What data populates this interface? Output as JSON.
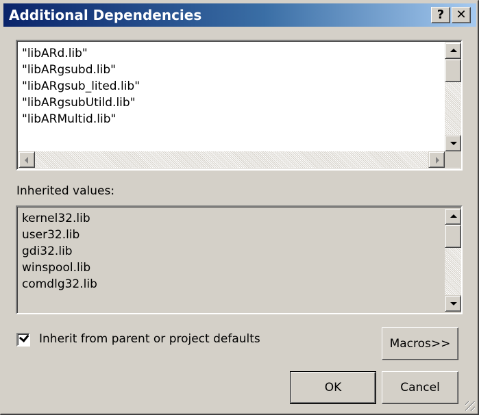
{
  "window": {
    "title": "Additional Dependencies",
    "help_label": "?",
    "close_label": "✕"
  },
  "dependencies": {
    "items": [
      "\"libARd.lib\"",
      "\"libARgsubd.lib\"",
      "\"libARgsub_lited.lib\"",
      "\"libARgsubUtild.lib\"",
      "\"libARMultid.lib\""
    ]
  },
  "inherited": {
    "label": "Inherited values:",
    "items": [
      "kernel32.lib",
      "user32.lib",
      "gdi32.lib",
      "winspool.lib",
      "comdlg32.lib"
    ]
  },
  "options": {
    "inherit_label": "Inherit from parent or project defaults",
    "inherit_checked": true
  },
  "buttons": {
    "macros": "Macros>>",
    "ok": "OK",
    "cancel": "Cancel"
  },
  "icons": {
    "help": "help-icon",
    "close": "close-icon",
    "checkbox": "checkmark-icon",
    "scroll_up": "arrow-up-icon",
    "scroll_down": "arrow-down-icon",
    "scroll_left": "arrow-left-icon",
    "scroll_right": "arrow-right-icon",
    "resize": "resize-grip-icon"
  }
}
